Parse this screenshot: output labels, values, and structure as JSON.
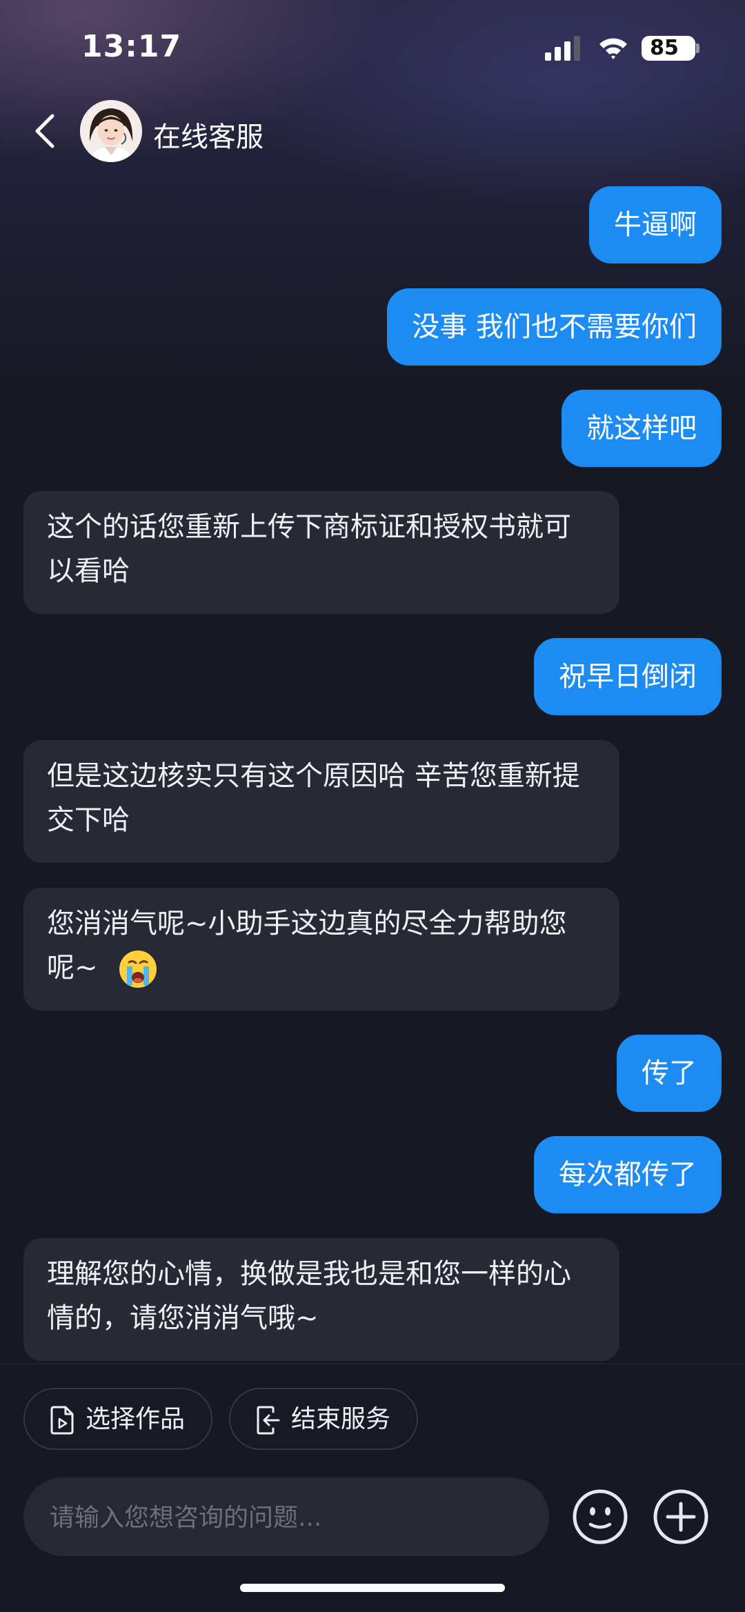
{
  "status_bar": {
    "time": "13:17",
    "battery": "85"
  },
  "header": {
    "title": "在线客服",
    "avatar": "customer-service-agent-avatar"
  },
  "messages": [
    {
      "side": "out",
      "text": "牛逼啊"
    },
    {
      "side": "out",
      "text": "没事 我们也不需要你们"
    },
    {
      "side": "out",
      "text": "就这样吧"
    },
    {
      "side": "in",
      "text": "这个的话您重新上传下商标证和授权书就可以看哈"
    },
    {
      "side": "out",
      "text": "祝早日倒闭"
    },
    {
      "side": "in",
      "text": "但是这边核实只有这个原因哈 辛苦您重新提交下哈"
    },
    {
      "side": "in",
      "text": "您消消气呢~小助手这边真的尽全力帮助您呢~",
      "emoji": "crying-face"
    },
    {
      "side": "out",
      "text": "传了"
    },
    {
      "side": "out",
      "text": "每次都传了"
    },
    {
      "side": "in",
      "text": "理解您的心情，换做是我也是和您一样的心情的，请您消消气哦~"
    }
  ],
  "actions": [
    {
      "label": "选择作品",
      "icon": "video-file-icon"
    },
    {
      "label": "结束服务",
      "icon": "exit-icon"
    }
  ],
  "input": {
    "placeholder": "请输入您想咨询的问题..."
  },
  "buttons": {
    "emoji": "emoji-icon",
    "more": "plus-icon"
  },
  "colors": {
    "outgoing_bubble": "#1c8cf3",
    "incoming_bubble": "#272a35",
    "background": "#161924"
  }
}
